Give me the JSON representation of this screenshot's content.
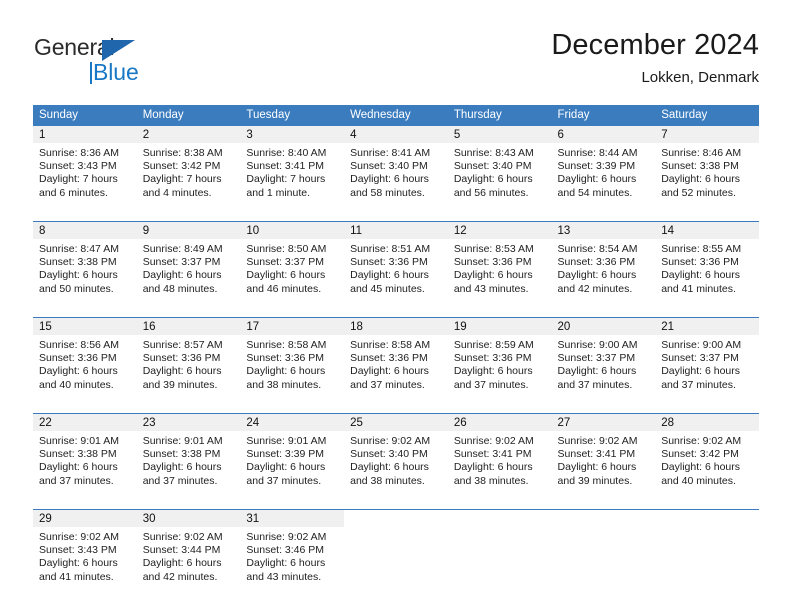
{
  "brand": {
    "name_part1": "General",
    "name_part2": "Blue",
    "triangle_icon": "triangle-icon",
    "color_dark": "#2b2b2b",
    "color_blue": "#1878c6"
  },
  "header": {
    "title": "December 2024",
    "subtitle": "Lokken, Denmark"
  },
  "theme": {
    "header_row_bg": "#3b7cbf",
    "daynum_bg": "#f0f0f0",
    "separator": "#3b7cbf",
    "text": "#222222"
  },
  "calendar": {
    "weekday_headers": [
      "Sunday",
      "Monday",
      "Tuesday",
      "Wednesday",
      "Thursday",
      "Friday",
      "Saturday"
    ],
    "labels": {
      "sunrise": "Sunrise:",
      "sunset": "Sunset:",
      "daylight": "Daylight:"
    },
    "weeks": [
      [
        {
          "day": "1",
          "sunrise": "Sunrise: 8:36 AM",
          "sunset": "Sunset: 3:43 PM",
          "daylight_line1": "Daylight: 7 hours",
          "daylight_line2": "and 6 minutes."
        },
        {
          "day": "2",
          "sunrise": "Sunrise: 8:38 AM",
          "sunset": "Sunset: 3:42 PM",
          "daylight_line1": "Daylight: 7 hours",
          "daylight_line2": "and 4 minutes."
        },
        {
          "day": "3",
          "sunrise": "Sunrise: 8:40 AM",
          "sunset": "Sunset: 3:41 PM",
          "daylight_line1": "Daylight: 7 hours",
          "daylight_line2": "and 1 minute."
        },
        {
          "day": "4",
          "sunrise": "Sunrise: 8:41 AM",
          "sunset": "Sunset: 3:40 PM",
          "daylight_line1": "Daylight: 6 hours",
          "daylight_line2": "and 58 minutes."
        },
        {
          "day": "5",
          "sunrise": "Sunrise: 8:43 AM",
          "sunset": "Sunset: 3:40 PM",
          "daylight_line1": "Daylight: 6 hours",
          "daylight_line2": "and 56 minutes."
        },
        {
          "day": "6",
          "sunrise": "Sunrise: 8:44 AM",
          "sunset": "Sunset: 3:39 PM",
          "daylight_line1": "Daylight: 6 hours",
          "daylight_line2": "and 54 minutes."
        },
        {
          "day": "7",
          "sunrise": "Sunrise: 8:46 AM",
          "sunset": "Sunset: 3:38 PM",
          "daylight_line1": "Daylight: 6 hours",
          "daylight_line2": "and 52 minutes."
        }
      ],
      [
        {
          "day": "8",
          "sunrise": "Sunrise: 8:47 AM",
          "sunset": "Sunset: 3:38 PM",
          "daylight_line1": "Daylight: 6 hours",
          "daylight_line2": "and 50 minutes."
        },
        {
          "day": "9",
          "sunrise": "Sunrise: 8:49 AM",
          "sunset": "Sunset: 3:37 PM",
          "daylight_line1": "Daylight: 6 hours",
          "daylight_line2": "and 48 minutes."
        },
        {
          "day": "10",
          "sunrise": "Sunrise: 8:50 AM",
          "sunset": "Sunset: 3:37 PM",
          "daylight_line1": "Daylight: 6 hours",
          "daylight_line2": "and 46 minutes."
        },
        {
          "day": "11",
          "sunrise": "Sunrise: 8:51 AM",
          "sunset": "Sunset: 3:36 PM",
          "daylight_line1": "Daylight: 6 hours",
          "daylight_line2": "and 45 minutes."
        },
        {
          "day": "12",
          "sunrise": "Sunrise: 8:53 AM",
          "sunset": "Sunset: 3:36 PM",
          "daylight_line1": "Daylight: 6 hours",
          "daylight_line2": "and 43 minutes."
        },
        {
          "day": "13",
          "sunrise": "Sunrise: 8:54 AM",
          "sunset": "Sunset: 3:36 PM",
          "daylight_line1": "Daylight: 6 hours",
          "daylight_line2": "and 42 minutes."
        },
        {
          "day": "14",
          "sunrise": "Sunrise: 8:55 AM",
          "sunset": "Sunset: 3:36 PM",
          "daylight_line1": "Daylight: 6 hours",
          "daylight_line2": "and 41 minutes."
        }
      ],
      [
        {
          "day": "15",
          "sunrise": "Sunrise: 8:56 AM",
          "sunset": "Sunset: 3:36 PM",
          "daylight_line1": "Daylight: 6 hours",
          "daylight_line2": "and 40 minutes."
        },
        {
          "day": "16",
          "sunrise": "Sunrise: 8:57 AM",
          "sunset": "Sunset: 3:36 PM",
          "daylight_line1": "Daylight: 6 hours",
          "daylight_line2": "and 39 minutes."
        },
        {
          "day": "17",
          "sunrise": "Sunrise: 8:58 AM",
          "sunset": "Sunset: 3:36 PM",
          "daylight_line1": "Daylight: 6 hours",
          "daylight_line2": "and 38 minutes."
        },
        {
          "day": "18",
          "sunrise": "Sunrise: 8:58 AM",
          "sunset": "Sunset: 3:36 PM",
          "daylight_line1": "Daylight: 6 hours",
          "daylight_line2": "and 37 minutes."
        },
        {
          "day": "19",
          "sunrise": "Sunrise: 8:59 AM",
          "sunset": "Sunset: 3:36 PM",
          "daylight_line1": "Daylight: 6 hours",
          "daylight_line2": "and 37 minutes."
        },
        {
          "day": "20",
          "sunrise": "Sunrise: 9:00 AM",
          "sunset": "Sunset: 3:37 PM",
          "daylight_line1": "Daylight: 6 hours",
          "daylight_line2": "and 37 minutes."
        },
        {
          "day": "21",
          "sunrise": "Sunrise: 9:00 AM",
          "sunset": "Sunset: 3:37 PM",
          "daylight_line1": "Daylight: 6 hours",
          "daylight_line2": "and 37 minutes."
        }
      ],
      [
        {
          "day": "22",
          "sunrise": "Sunrise: 9:01 AM",
          "sunset": "Sunset: 3:38 PM",
          "daylight_line1": "Daylight: 6 hours",
          "daylight_line2": "and 37 minutes."
        },
        {
          "day": "23",
          "sunrise": "Sunrise: 9:01 AM",
          "sunset": "Sunset: 3:38 PM",
          "daylight_line1": "Daylight: 6 hours",
          "daylight_line2": "and 37 minutes."
        },
        {
          "day": "24",
          "sunrise": "Sunrise: 9:01 AM",
          "sunset": "Sunset: 3:39 PM",
          "daylight_line1": "Daylight: 6 hours",
          "daylight_line2": "and 37 minutes."
        },
        {
          "day": "25",
          "sunrise": "Sunrise: 9:02 AM",
          "sunset": "Sunset: 3:40 PM",
          "daylight_line1": "Daylight: 6 hours",
          "daylight_line2": "and 38 minutes."
        },
        {
          "day": "26",
          "sunrise": "Sunrise: 9:02 AM",
          "sunset": "Sunset: 3:41 PM",
          "daylight_line1": "Daylight: 6 hours",
          "daylight_line2": "and 38 minutes."
        },
        {
          "day": "27",
          "sunrise": "Sunrise: 9:02 AM",
          "sunset": "Sunset: 3:41 PM",
          "daylight_line1": "Daylight: 6 hours",
          "daylight_line2": "and 39 minutes."
        },
        {
          "day": "28",
          "sunrise": "Sunrise: 9:02 AM",
          "sunset": "Sunset: 3:42 PM",
          "daylight_line1": "Daylight: 6 hours",
          "daylight_line2": "and 40 minutes."
        }
      ],
      [
        {
          "day": "29",
          "sunrise": "Sunrise: 9:02 AM",
          "sunset": "Sunset: 3:43 PM",
          "daylight_line1": "Daylight: 6 hours",
          "daylight_line2": "and 41 minutes."
        },
        {
          "day": "30",
          "sunrise": "Sunrise: 9:02 AM",
          "sunset": "Sunset: 3:44 PM",
          "daylight_line1": "Daylight: 6 hours",
          "daylight_line2": "and 42 minutes."
        },
        {
          "day": "31",
          "sunrise": "Sunrise: 9:02 AM",
          "sunset": "Sunset: 3:46 PM",
          "daylight_line1": "Daylight: 6 hours",
          "daylight_line2": "and 43 minutes."
        },
        {
          "day": "",
          "sunrise": "",
          "sunset": "",
          "daylight_line1": "",
          "daylight_line2": ""
        },
        {
          "day": "",
          "sunrise": "",
          "sunset": "",
          "daylight_line1": "",
          "daylight_line2": ""
        },
        {
          "day": "",
          "sunrise": "",
          "sunset": "",
          "daylight_line1": "",
          "daylight_line2": ""
        },
        {
          "day": "",
          "sunrise": "",
          "sunset": "",
          "daylight_line1": "",
          "daylight_line2": ""
        }
      ]
    ]
  }
}
